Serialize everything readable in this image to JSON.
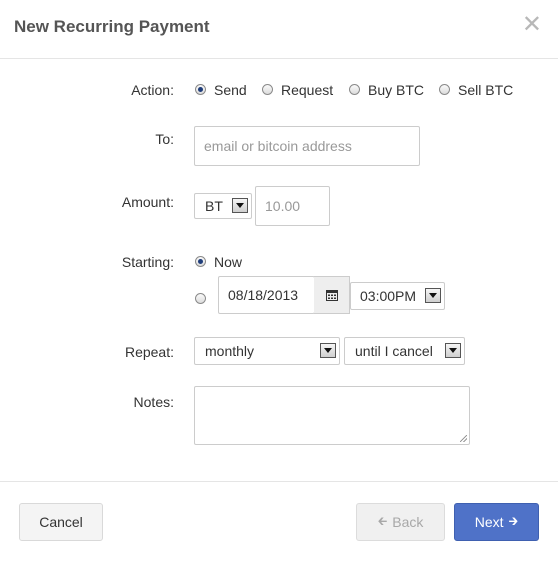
{
  "dialog": {
    "title": "New Recurring Payment",
    "close_glyph": "✕"
  },
  "action": {
    "label": "Action:",
    "options": [
      "Send",
      "Request",
      "Buy BTC",
      "Sell BTC"
    ],
    "selected": "Send"
  },
  "to": {
    "label": "To:",
    "placeholder": "email or bitcoin address",
    "value": ""
  },
  "amount": {
    "label": "Amount:",
    "currency": "BT",
    "placeholder": "10.00",
    "value": ""
  },
  "starting": {
    "label": "Starting:",
    "now_label": "Now",
    "selected": "Now",
    "date": "08/18/2013",
    "time": "03:00PM",
    "calendar_icon": "calendar-icon"
  },
  "repeat": {
    "label": "Repeat:",
    "frequency": "monthly",
    "until": "until I cancel"
  },
  "notes": {
    "label": "Notes:",
    "value": ""
  },
  "footer": {
    "cancel_label": "Cancel",
    "back_label": "Back",
    "next_label": "Next",
    "back_icon": "arrow-left-icon",
    "next_icon": "arrow-right-icon"
  },
  "colors": {
    "primary": "#4f72c8",
    "disabled_text": "#a8a8a8",
    "title": "#555555"
  }
}
